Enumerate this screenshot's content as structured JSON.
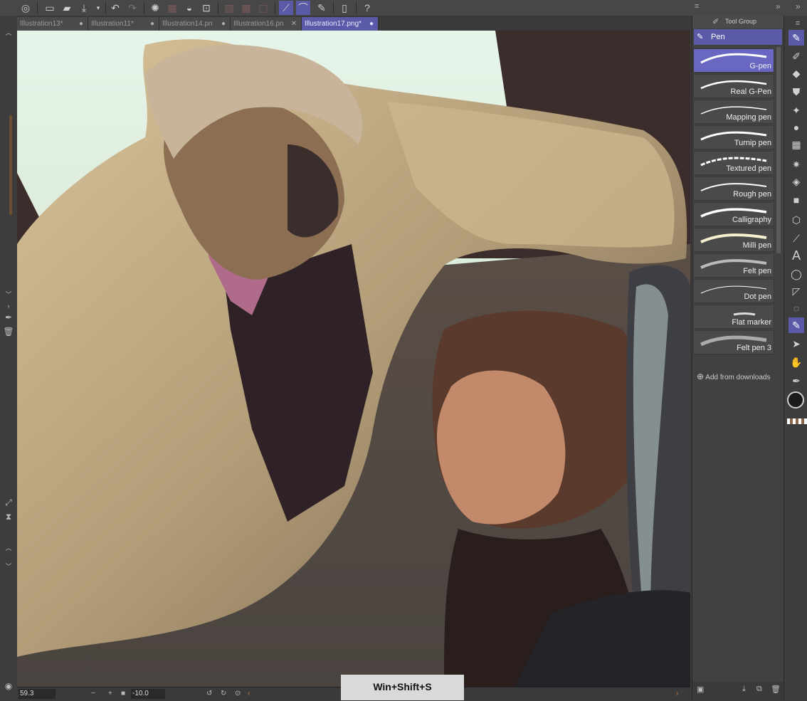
{
  "toolbar": {
    "icons": [
      "app-icon",
      "new-file-icon",
      "open-folder-icon",
      "export-icon",
      "undo-icon",
      "redo-icon",
      "loading-spinner-icon",
      "transform-icon",
      "fill-icon",
      "crop-icon",
      "snap-ruler-icon",
      "snap-grid-icon",
      "pen-pressure-icon",
      "stroke-icon",
      "edit-icon",
      "device-icon",
      "help-icon"
    ]
  },
  "tabs": [
    {
      "label": "Illustration13*",
      "active": false
    },
    {
      "label": "Illustration11*",
      "active": false
    },
    {
      "label": "Illustration14.pn",
      "active": false
    },
    {
      "label": "Illustration16.pn",
      "active": false
    },
    {
      "label": "Illustration17.png*",
      "active": true
    }
  ],
  "status": {
    "zoom": "59.3",
    "angle": "-10.0",
    "minus": "−",
    "plus": "+",
    "shortcut": "Win+Shift+S"
  },
  "panel": {
    "title": "Tool Group",
    "active_tool": "Pen",
    "brushes": [
      {
        "name": "G-pen",
        "selected": true
      },
      {
        "name": "Real G-Pen",
        "selected": false
      },
      {
        "name": "Mapping pen",
        "selected": false
      },
      {
        "name": "Turnip pen",
        "selected": false
      },
      {
        "name": "Textured pen",
        "selected": false
      },
      {
        "name": "Rough pen",
        "selected": false
      },
      {
        "name": "Calligraphy",
        "selected": false
      },
      {
        "name": "Milli pen",
        "selected": false
      },
      {
        "name": "Felt pen",
        "selected": false
      },
      {
        "name": "Dot pen",
        "selected": false
      },
      {
        "name": "Flat marker",
        "selected": false
      },
      {
        "name": "Felt pen 3",
        "selected": false
      }
    ],
    "add_downloads": "Add from downloads"
  },
  "tools": [
    "pen-tool-icon",
    "pencil-icon",
    "eraser-icon",
    "blend-icon",
    "sparkle-icon",
    "paint-drop-icon",
    "mesh-icon",
    "star-icon",
    "fill-bucket-icon",
    "gradient-icon",
    "3d-figure-icon",
    "line-icon",
    "text-icon",
    "lasso-icon",
    "shape-icon",
    "auto-select-icon",
    "pen-active-icon",
    "select-arrow-icon",
    "hand-icon",
    "eyedropper-icon"
  ],
  "colors": {
    "accent": "#5b5aa8",
    "main_color": "#1d1a1a"
  }
}
